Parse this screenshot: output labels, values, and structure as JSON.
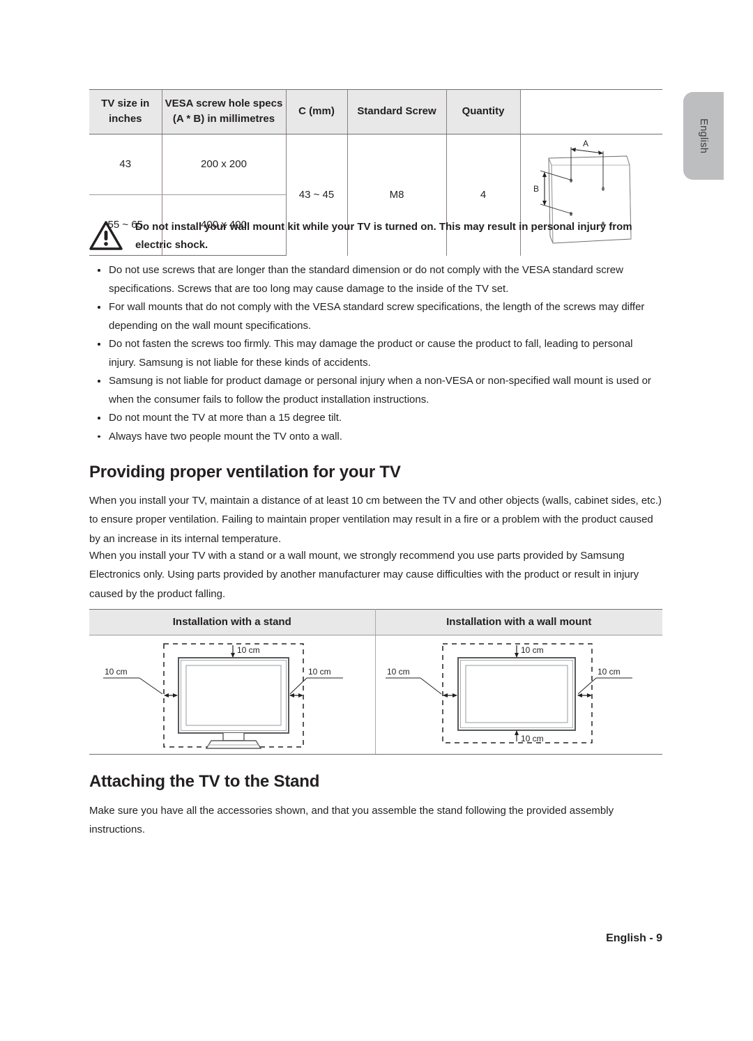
{
  "page": {
    "language_tab": "English",
    "footer": "English - 9"
  },
  "vesa_table": {
    "headers": [
      "TV size in inches",
      "VESA screw hole specs (A * B) in millimetres",
      "C (mm)",
      "Standard Screw",
      "Quantity",
      ""
    ],
    "rows": [
      {
        "tv_size": "43",
        "vesa_spec": "200 x 200",
        "c_mm": "43 ~ 45",
        "standard_screw": "M8",
        "quantity": "4"
      },
      {
        "tv_size": "55 ~ 65",
        "vesa_spec": "400 x 400",
        "c_mm": "",
        "standard_screw": "",
        "quantity": ""
      }
    ],
    "diagram": {
      "label_a": "A",
      "label_b": "B"
    }
  },
  "warning": {
    "icon": "warning-triangle-icon",
    "text": "Do not install your wall mount kit while your TV is turned on. This may result in personal injury from electric shock."
  },
  "bullets": [
    "Do not use screws that are longer than the standard dimension or do not comply with the VESA standard screw specifications. Screws that are too long may cause damage to the inside of the TV set.",
    "For wall mounts that do not comply with the VESA standard screw specifications, the length of the screws may differ depending on the wall mount specifications.",
    "Do not fasten the screws too firmly. This may damage the product or cause the product to fall, leading to personal injury. Samsung is not liable for these kinds of accidents.",
    "Samsung is not liable for product damage or personal injury when a non-VESA or non-specified wall mount is used or when the consumer fails to follow the product installation instructions.",
    "Do not mount the TV at more than a 15 degree tilt.",
    "Always have two people mount the TV onto a wall."
  ],
  "ventilation": {
    "heading": "Providing proper ventilation for your TV",
    "paragraph_1": "When you install your TV, maintain a distance of at least 10 cm between the TV and other objects (walls, cabinet sides, etc.) to ensure proper ventilation. Failing to maintain proper ventilation may result in a fire or a problem with the product caused by an increase in its internal temperature.",
    "paragraph_2": "When you install your TV with a stand or a wall mount, we strongly recommend you use parts provided by Samsung Electronics only. Using parts provided by another manufacturer may cause difficulties with the product or result in injury caused by the product falling."
  },
  "install_table": {
    "header_stand": "Installation with a stand",
    "header_wall": "Installation with a wall mount",
    "stand_labels": {
      "top": "10 cm",
      "left": "10 cm",
      "right": "10 cm"
    },
    "wall_labels": {
      "top": "10 cm",
      "left": "10 cm",
      "right": "10 cm",
      "bottom": "10 cm"
    }
  },
  "attaching": {
    "heading": "Attaching the TV to the Stand",
    "paragraph_1": "Make sure you have all the accessories shown, and that you assemble the stand following the provided assembly instructions."
  }
}
